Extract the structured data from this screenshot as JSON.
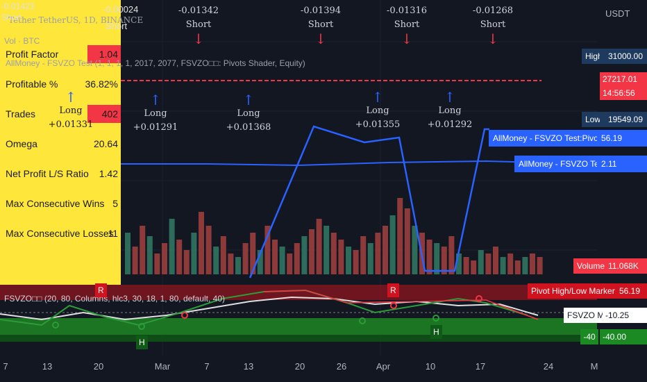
{
  "header": {
    "symbol_line": "Tether TetherUS, 1D, BINANCE",
    "vol_line": "Vol · BTC",
    "strategy_line": "AllMoney - FSVZO Test (1, 1, 1, 1, 2017, 2077, FSVZO□□: Pivots Shader, Equity)",
    "currency": "USDT",
    "overlay_tl": "-0.01423",
    "overlay_tl2": "Short",
    "overlay_tr": "-0.00024",
    "overlay_tr2": "Short"
  },
  "stats": [
    {
      "label": "Profit Factor",
      "value": "1.04",
      "highlight": true
    },
    {
      "label": "Profitable %",
      "value": "36.82%",
      "highlight": false
    },
    {
      "label": "Trades",
      "value": "402",
      "highlight": true
    },
    {
      "label": "Omega",
      "value": "20.64",
      "highlight": false
    },
    {
      "label": "Net Profit L/S Ratio",
      "value": "1.42",
      "highlight": false
    },
    {
      "label": "Max Consecutive Wins",
      "value": "5",
      "highlight": false
    },
    {
      "label": "Max Consecutive Losses",
      "value": "11",
      "highlight": false
    }
  ],
  "annotations": {
    "shorts": [
      {
        "value": "-0.01342",
        "label": "Short"
      },
      {
        "value": "-0.01394",
        "label": "Short"
      },
      {
        "value": "-0.01316",
        "label": "Short"
      },
      {
        "value": "-0.01268",
        "label": "Short"
      }
    ],
    "longs": [
      {
        "value": "+0.01331",
        "label": "Long"
      },
      {
        "value": "+0.01291",
        "label": "Long"
      },
      {
        "value": "+0.01368",
        "label": "Long"
      },
      {
        "value": "+0.01355",
        "label": "Long"
      },
      {
        "value": "+0.01292",
        "label": "Long"
      }
    ]
  },
  "right_axis": {
    "high_label": "High",
    "high_value": "31000.00",
    "price": "27217.01",
    "countdown": "14:56:56",
    "low_label": "Low",
    "low_value": "19549.09",
    "volume_label": "Volume",
    "volume_value": "11.068K",
    "pivot_label": "Pivot High/Low Marker",
    "pivot_value": "56.19",
    "ma_label": "FSVZO MA",
    "ma_value": "-10.25",
    "level_value": "-40",
    "level_value2": "-40.00"
  },
  "legend_boxes": {
    "pivots_label": "AllMoney  - FSVZO Test:Pivots Shader",
    "pivots_value": "56.19",
    "plot_label": "AllMoney  - FSVZO Test:Plot",
    "plot_value": "2.11"
  },
  "oscillator": {
    "title": "FSVZO□□ (20, 80, Columns, hlc3, 30, 18, 1, 80, default, 40)",
    "markers": [
      "R",
      "R",
      "H",
      "H"
    ]
  },
  "xaxis": [
    "7",
    "13",
    "20",
    "Mar",
    "7",
    "13",
    "20",
    "26",
    "Apr",
    "10",
    "17",
    "24",
    "M"
  ],
  "colors": {
    "background": "#131722",
    "panel_yellow": "#ffe63b",
    "red": "#f23645",
    "green": "#089981",
    "blue": "#2962ff",
    "navy": "#1e3a5f"
  }
}
